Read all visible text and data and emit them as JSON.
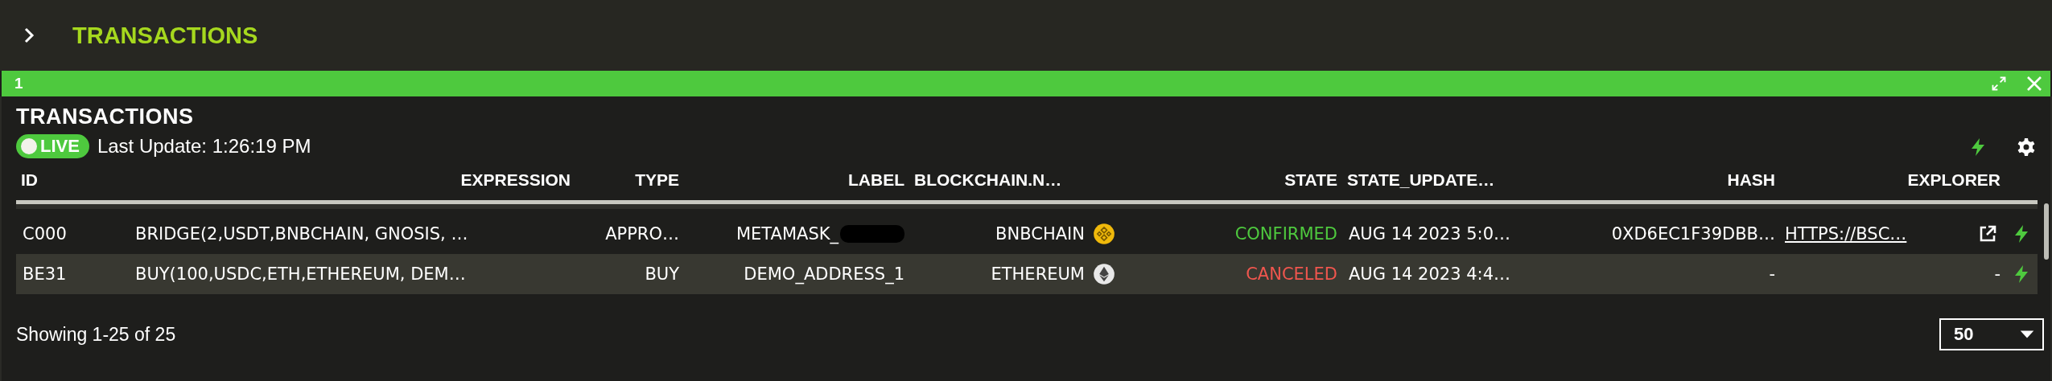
{
  "header": {
    "title": "TRANSACTIONS",
    "expanded": false
  },
  "panel": {
    "tab": "1",
    "title": "TRANSACTIONS",
    "live": {
      "label": "LIVE",
      "on": true
    },
    "last_update": "Last Update: 1:26:19 PM"
  },
  "table": {
    "columns": [
      "ID",
      "EXPRESSION",
      "TYPE",
      "LABEL",
      "BLOCKCHAIN.N…",
      "STATE",
      "STATE_UPDATE…",
      "HASH",
      "EXPLORER"
    ],
    "rows": [
      {
        "id": "C000",
        "expression": "BRIDGE(2,USDT,BNBCHAIN, GNOSIS, …",
        "type": "APPRO…",
        "label": {
          "text": "METAMASK_",
          "redacted": true
        },
        "blockchain": {
          "text": "BNBCHAIN",
          "kind": "bnb"
        },
        "state": {
          "text": "CONFIRMED",
          "color": "#4ec93e"
        },
        "state_updated": "AUG 14 2023 5:0…",
        "hash": "0XD6EC1F39DBB…",
        "explorer": {
          "text": "HTTPS://BSC…",
          "kind": "link"
        }
      },
      {
        "id": "BE31",
        "expression": "BUY(100,USDC,ETH,ETHEREUM, DEM…",
        "type": "BUY",
        "label": {
          "text": "DEMO_ADDRESS_1",
          "redacted": false
        },
        "blockchain": {
          "text": "ETHEREUM",
          "kind": "eth"
        },
        "state": {
          "text": "CANCELED",
          "color": "#f0564e"
        },
        "state_updated": "AUG 14 2023 4:4…",
        "hash": "-",
        "explorer": {
          "text": "-",
          "kind": "none"
        }
      }
    ]
  },
  "footer": {
    "showing": "Showing 1-25 of 25",
    "page_size": "50"
  }
}
